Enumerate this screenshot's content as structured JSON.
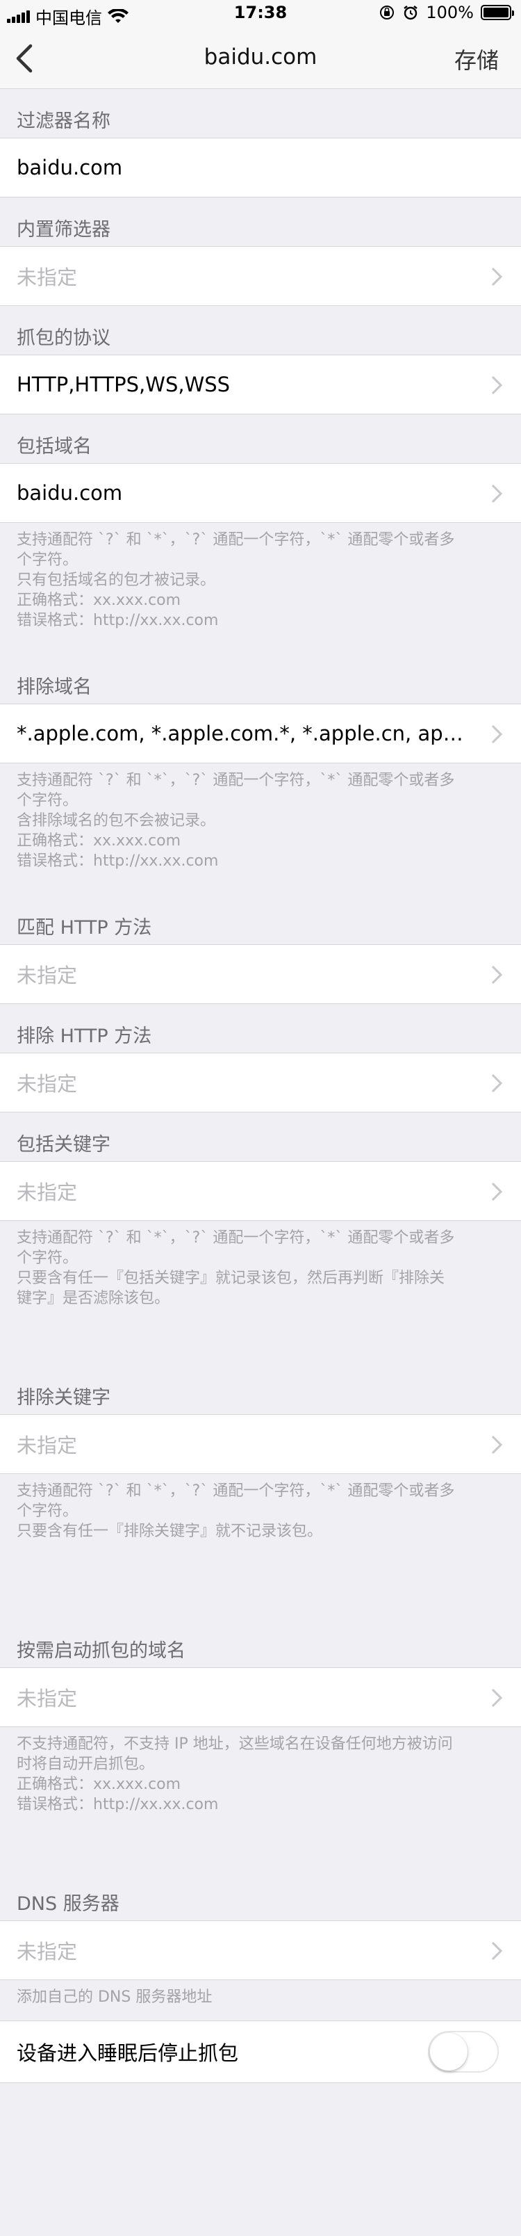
{
  "status_bar": {
    "carrier": "中国电信",
    "time": "17:38",
    "battery": "100%"
  },
  "nav": {
    "title": "baidu.com",
    "save_label": "存储"
  },
  "sections": {
    "filter_name": {
      "header": "过滤器名称",
      "value": "baidu.com"
    },
    "builtin_filter": {
      "header": "内置筛选器",
      "placeholder": "未指定"
    },
    "protocol": {
      "header": "抓包的协议",
      "value": "HTTP,HTTPS,WS,WSS"
    },
    "include_domain": {
      "header": "包括域名",
      "value": "baidu.com",
      "footer": [
        "支持通配符 `?` 和 `*`，`?` 通配一个字符，`*` 通配零个或者多",
        "个字符。",
        "只有包括域名的包才被记录。",
        "正确格式：xx.xxx.com",
        "错误格式：http://xx.xx.com"
      ]
    },
    "exclude_domain": {
      "header": "排除域名",
      "value": "*.apple.com, *.apple.com.*, *.apple.cn, apps.i...",
      "footer": [
        "支持通配符 `?` 和 `*`，`?` 通配一个字符，`*` 通配零个或者多",
        "个字符。",
        "含排除域名的包不会被记录。",
        "正确格式：xx.xxx.com",
        "错误格式：http://xx.xx.com"
      ]
    },
    "match_http_method": {
      "header": "匹配 HTTP 方法",
      "placeholder": "未指定"
    },
    "exclude_http_method": {
      "header": "排除 HTTP 方法",
      "placeholder": "未指定"
    },
    "include_keyword": {
      "header": "包括关键字",
      "placeholder": "未指定",
      "footer": [
        "支持通配符 `?` 和 `*`，`?` 通配一个字符，`*` 通配零个或者多",
        "个字符。",
        "只要含有任一『包括关键字』就记录该包，然后再判断『排除关",
        "键字』是否滤除该包。"
      ]
    },
    "exclude_keyword": {
      "header": "排除关键字",
      "placeholder": "未指定",
      "footer": [
        "支持通配符 `?` 和 `*`，`?` 通配一个字符，`*` 通配零个或者多",
        "个字符。",
        "只要含有任一『排除关键字』就不记录该包。"
      ]
    },
    "on_demand_domain": {
      "header": "按需启动抓包的域名",
      "placeholder": "未指定",
      "footer": [
        "不支持通配符，不支持 IP 地址，这些域名在设备任何地方被访问",
        "时将自动开启抓包。",
        "正确格式：xx.xxx.com",
        "错误格式：http://xx.xx.com"
      ]
    },
    "dns_server": {
      "header": "DNS 服务器",
      "placeholder": "未指定",
      "footer": [
        "添加自己的 DNS 服务器地址"
      ]
    },
    "sleep_stop": {
      "label": "设备进入睡眠后停止抓包",
      "enabled": false
    }
  }
}
